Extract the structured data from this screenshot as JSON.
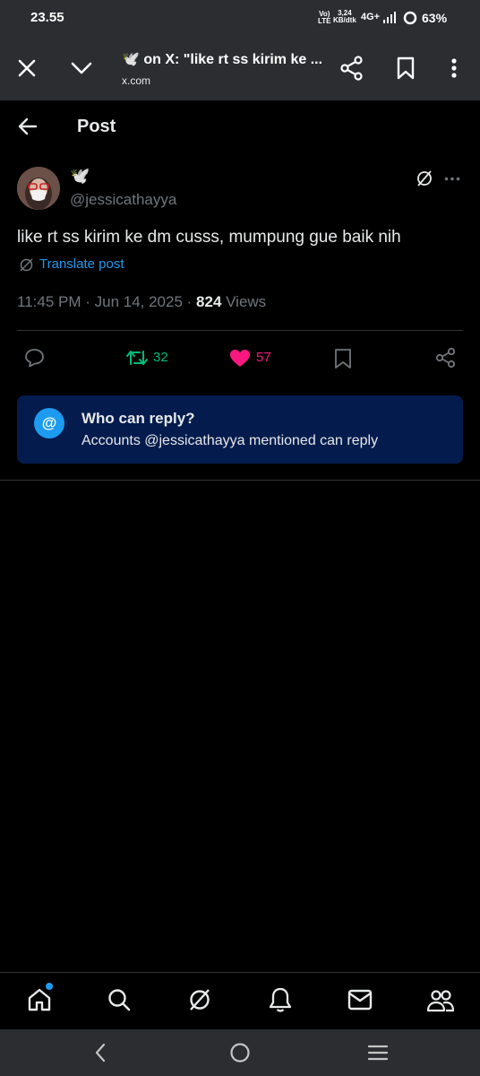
{
  "status_bar": {
    "time": "23.55",
    "volte_top": "Vo)",
    "volte_bottom": "LTE",
    "speed_top": "3,24",
    "speed_bottom": "KB/dtk",
    "network": "4G+",
    "battery": "63%"
  },
  "browser": {
    "title": "🕊️ on X: \"like rt ss kirim ke ...",
    "url": "x.com"
  },
  "post_header": {
    "title": "Post"
  },
  "post": {
    "display_name": "🕊️",
    "handle": "@jessicathayya",
    "text": "like rt ss kirim ke dm cusss, mumpung gue baik nih",
    "translate_label": "Translate post",
    "timestamp": "11:45 PM · Jun 14, 2025 · ",
    "views_count": "824",
    "views_label": " Views",
    "retweets": "32",
    "likes": "57"
  },
  "reply_notice": {
    "icon_text": "@",
    "title": "Who can reply?",
    "subtitle": "Accounts @jessicathayya mentioned can reply"
  },
  "colors": {
    "accent": "#1d9bf0",
    "retweet": "#00ba7c",
    "like": "#f91880",
    "card_bg": "#031c4d"
  },
  "bottom_nav": [
    "home-icon",
    "search-icon",
    "grok-icon",
    "notifications-icon",
    "messages-icon",
    "communities-icon"
  ]
}
